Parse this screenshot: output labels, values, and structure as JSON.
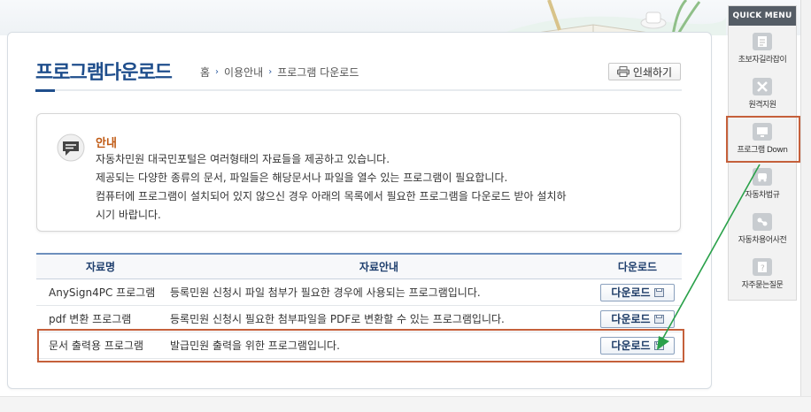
{
  "page": {
    "title": "프로그램다운로드",
    "breadcrumb": [
      "홈",
      "이용안내",
      "프로그램 다운로드"
    ],
    "print_label": "인쇄하기"
  },
  "notice": {
    "title": "안내",
    "lines": [
      "자동차민원 대국민포털은 여러형태의 자료들을 제공하고 있습니다.",
      "제공되는 다양한 종류의 문서, 파일들은 해당문서나 파일을 열수 있는 프로그램이 필요합니다.",
      "컴퓨터에 프로그램이 설치되어 있지 않으신 경우 아래의 목록에서 필요한 프로그램을 다운로드 받아 설치하",
      "시기 바랍니다."
    ]
  },
  "table": {
    "headers": [
      "자료명",
      "자료안내",
      "다운로드"
    ],
    "rows": [
      {
        "name": "AnySign4PC 프로그램",
        "desc": "등록민원 신청시 파일 첨부가 필요한 경우에 사용되는 프로그램입니다.",
        "button": "다운로드"
      },
      {
        "name": "pdf 변환 프로그램",
        "desc": "등록민원 신청시 필요한 첨부파일을 PDF로 변환할 수 있는 프로그램입니다.",
        "button": "다운로드"
      },
      {
        "name": "문서 출력용 프로그램",
        "desc": "발급민원 출력을 위한 프로그램입니다.",
        "button": "다운로드"
      }
    ]
  },
  "quick_menu": {
    "title": "QUICK MENU",
    "items": [
      {
        "label": "초보자길라잡이",
        "icon": "document-icon"
      },
      {
        "label": "원격지원",
        "icon": "tools-icon"
      },
      {
        "label": "프로그램 Down",
        "icon": "monitor-icon"
      },
      {
        "label": "자동차법규",
        "icon": "car-icon"
      },
      {
        "label": "자동차용어사전",
        "icon": "link-icon"
      },
      {
        "label": "자주묻는질문",
        "icon": "question-icon"
      }
    ]
  },
  "colors": {
    "title_blue": "#1f4e8c",
    "notice_title": "#c05a14",
    "highlight": "#c5603b",
    "arrow": "#2aa14a"
  }
}
